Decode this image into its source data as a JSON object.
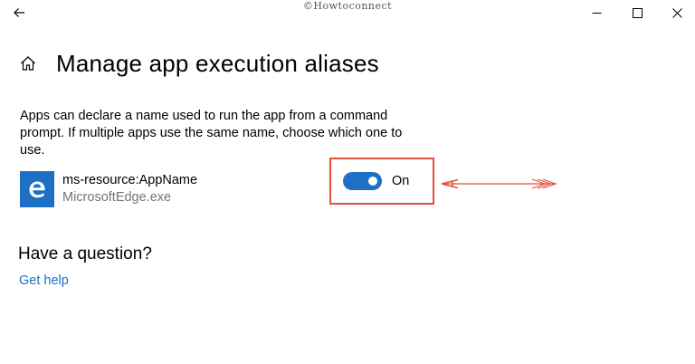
{
  "titlebar": {
    "watermark": "©Howtoconnect",
    "icons": {
      "back": "back-arrow-icon",
      "minimize": "minimize-icon",
      "maximize": "maximize-icon",
      "close": "close-icon"
    }
  },
  "header": {
    "home_icon": "home-icon",
    "title": "Manage app execution aliases"
  },
  "description": "Apps can declare a name used to run the app from a command prompt. If multiple apps use the same name, choose which one to use.",
  "aliases": [
    {
      "icon": "edge-icon",
      "name": "ms-resource:AppName",
      "executable": "MicrosoftEdge.exe",
      "toggle_state": "On",
      "enabled": true
    }
  ],
  "help": {
    "heading": "Have a question?",
    "link": "Get help"
  },
  "colors": {
    "accent": "#1e6fc6",
    "annotation": "#e0503c",
    "secondary_text": "#767676"
  }
}
